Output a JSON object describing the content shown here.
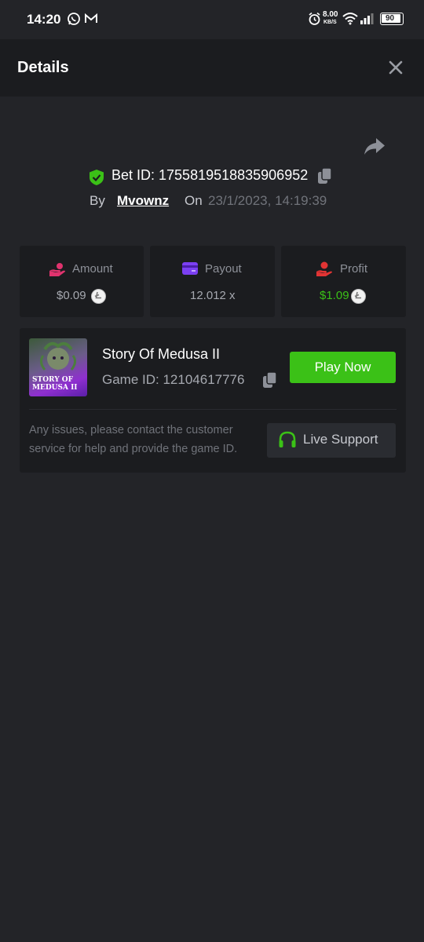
{
  "status_bar": {
    "time": "14:20",
    "net_speed": "8.00",
    "net_unit": "KB/S",
    "battery": "90"
  },
  "header": {
    "title": "Details"
  },
  "bet": {
    "id_label": "Bet ID: 1755819518835906952",
    "by_label": "By",
    "user": "Mvownz",
    "on_label": "On",
    "date": "23/1/2023, 14:19:39"
  },
  "stats": {
    "amount": {
      "label": "Amount",
      "value": "$0.09",
      "icon": "hand-coins-icon"
    },
    "payout": {
      "label": "Payout",
      "value": "12.012 x",
      "icon": "wallet-card-icon"
    },
    "profit": {
      "label": "Profit",
      "value": "$1.09",
      "icon": "hand-profit-icon"
    }
  },
  "game": {
    "title": "Story Of Medusa II",
    "id_label": "Game ID: 12104617776",
    "thumb_line1": "STORY OF",
    "thumb_line2": "MEDUSA II",
    "play_label": "Play Now",
    "help_text": "Any issues, please contact the customer service for help and provide the game ID.",
    "support_label": "Live Support"
  },
  "colors": {
    "background": "#232428",
    "card": "#1b1c1f",
    "accent_green": "#3bc117",
    "profit_green": "#3bc117",
    "amount_icon": "#e0336e",
    "payout_icon": "#7b3ff2",
    "profit_icon": "#e23434"
  }
}
